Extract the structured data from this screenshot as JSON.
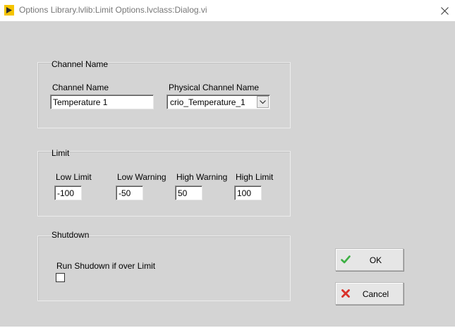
{
  "window": {
    "title": "Options Library.lvlib:Limit Options.lvclass:Dialog.vi",
    "icon": "labview-icon",
    "close_icon": "close-icon"
  },
  "channel_group": {
    "label": "Channel Name",
    "channel_name_label": "Channel Name",
    "channel_name_value": "Temperature 1",
    "physical_channel_label": "Physical Channel Name",
    "physical_channel_value": "crio_Temperature_1"
  },
  "limit_group": {
    "label": "Limit",
    "low_limit_label": "Low Limit",
    "low_limit_value": "-100",
    "low_warning_label": "Low Warning",
    "low_warning_value": "-50",
    "high_warning_label": "High Warning",
    "high_warning_value": "50",
    "high_limit_label": "High Limit",
    "high_limit_value": "100"
  },
  "shutdown_group": {
    "label": "Shutdown",
    "run_shutdown_label": "Run Shudown if over Limit",
    "run_shutdown_checked": false
  },
  "buttons": {
    "ok_label": "OK",
    "ok_icon": "checkmark-icon",
    "ok_icon_color": "#3cb043",
    "cancel_label": "Cancel",
    "cancel_icon": "x-icon",
    "cancel_icon_color": "#d9322b"
  }
}
